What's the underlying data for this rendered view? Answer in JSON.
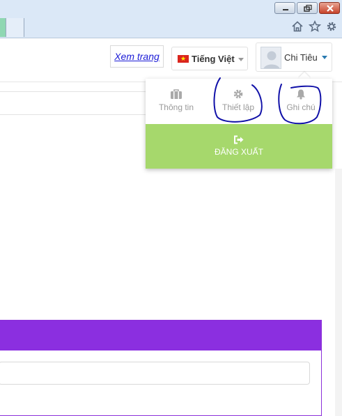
{
  "browser": {
    "window_controls": [
      "minimize",
      "restore",
      "close"
    ],
    "toolbar_icons": [
      "home-icon",
      "star-icon",
      "gear-icon"
    ]
  },
  "header": {
    "view_site_link": "Xem trang",
    "language": {
      "label": "Tiếng Việt",
      "flag": "vietnam-flag"
    },
    "user": {
      "name": "Chi Tiêu"
    }
  },
  "user_menu": {
    "items": [
      {
        "label": "Thông tin",
        "icon": "briefcase-icon"
      },
      {
        "label": "Thiết lập",
        "icon": "gear-icon"
      },
      {
        "label": "Ghi chú",
        "icon": "bell-icon"
      }
    ],
    "logout": {
      "label": "ĐĂNG XUẤT",
      "icon": "sign-out-icon",
      "color": "#a6d86c"
    }
  },
  "colors": {
    "accent_purple": "#8b2fe0",
    "annotation_blue": "#1010a8",
    "link_blue": "#1a1ad6"
  }
}
